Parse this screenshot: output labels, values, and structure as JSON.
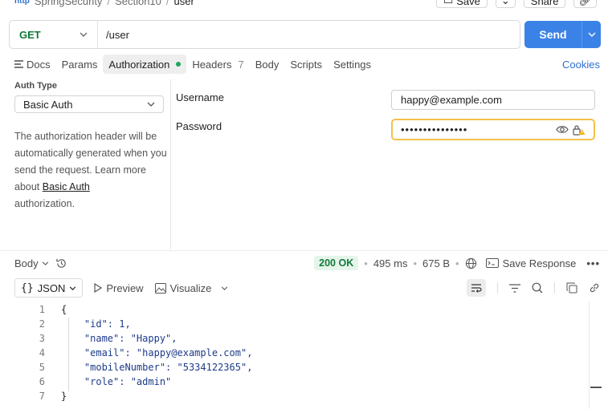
{
  "breadcrumb": {
    "workspace": "SpringSecurity",
    "folder": "Section10",
    "request": "user",
    "separator": "/"
  },
  "header_actions": {
    "save_label": "Save",
    "share_label": "Share"
  },
  "request": {
    "method": "GET",
    "url": "/user",
    "send_label": "Send"
  },
  "tabs": [
    {
      "label": "Docs"
    },
    {
      "label": "Params"
    },
    {
      "label": "Authorization"
    },
    {
      "label": "Headers",
      "count": "7"
    },
    {
      "label": "Body"
    },
    {
      "label": "Scripts"
    },
    {
      "label": "Settings"
    }
  ],
  "cookies_label": "Cookies",
  "auth": {
    "type_label": "Auth Type",
    "type_value": "Basic Auth",
    "help_text_1": "The authorization header will be automatically generated when you send the request. Learn more about",
    "help_link": "Basic Auth",
    "help_text_2": "authorization.",
    "username_label": "Username",
    "username_value": "happy@example.com",
    "password_label": "Password",
    "password_mask": "•••••••••••••••"
  },
  "response": {
    "body_label": "Body",
    "status": "200 OK",
    "time": "495 ms",
    "size": "675 B",
    "save_response_label": "Save Response",
    "format_label": "JSON",
    "preview_label": "Preview",
    "visualize_label": "Visualize",
    "lines": [
      {
        "no": "1",
        "text": "{"
      },
      {
        "no": "2",
        "text": "    \"id\": 1,"
      },
      {
        "no": "3",
        "text": "    \"name\": \"Happy\","
      },
      {
        "no": "4",
        "text": "    \"email\": \"happy@example.com\","
      },
      {
        "no": "5",
        "text": "    \"mobileNumber\": \"5334122365\","
      },
      {
        "no": "6",
        "text": "    \"role\": \"admin\""
      },
      {
        "no": "7",
        "text": "}"
      }
    ]
  },
  "colors": {
    "send": "#3b82e6",
    "method": "#0f7a3a",
    "status_ok": "#137a3c",
    "password_focus": "#f2c14b",
    "link": "#2f6fd1"
  }
}
